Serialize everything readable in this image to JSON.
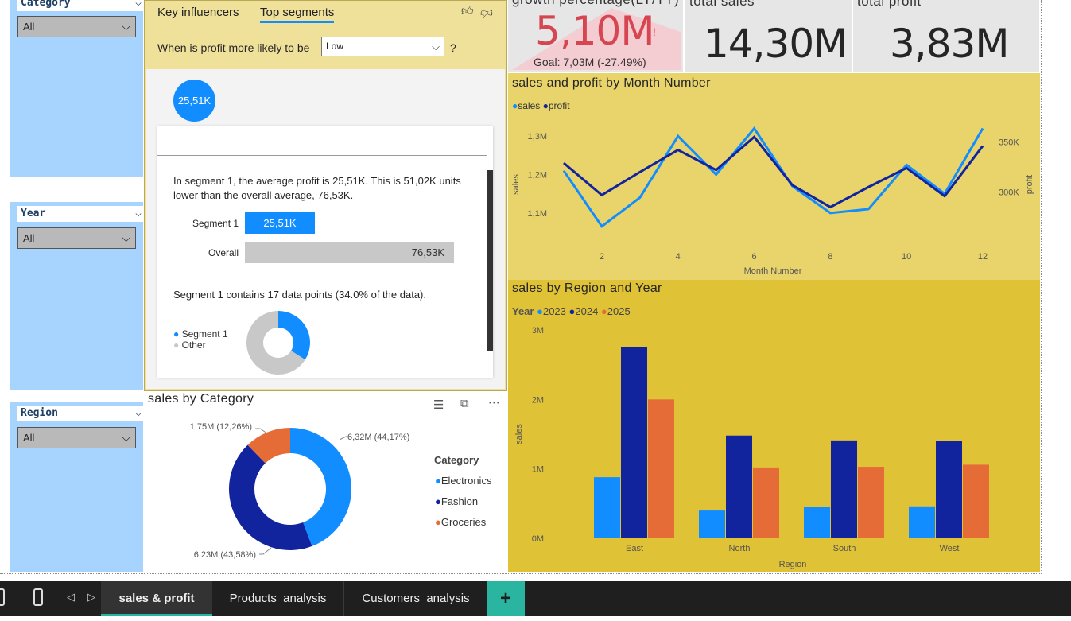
{
  "slicers": [
    {
      "title": "Category",
      "value": "All"
    },
    {
      "title": "Year",
      "value": "All"
    },
    {
      "title": "Region",
      "value": "All"
    }
  ],
  "key_influencers": {
    "tabs": [
      "Key influencers",
      "Top segments"
    ],
    "question_prefix": "When is profit more likely to be",
    "question_value": "Low",
    "question_suffix": "?",
    "segment_bubble": "25,51K",
    "segment_description": "In segment 1, the average profit is 25,51K. This is 51,02K units lower than the overall average, 76,53K.",
    "segment_label": "Segment 1",
    "segment_value": "25,51K",
    "overall_label": "Overall",
    "overall_value": "76,53K",
    "segment_value_num": 25.51,
    "overall_value_num": 76.53,
    "data_points_text": "Segment 1 contains 17 data points (34.0% of the data).",
    "share_percent": 34.0,
    "legend": [
      "Segment 1",
      "Other"
    ]
  },
  "kpis": [
    {
      "title": "growth percentage(LY/TY)",
      "value": "5,10M",
      "marker": "!",
      "goal": "Goal: 7,03M (-27.49%)",
      "color": "#d64550"
    },
    {
      "title": "total sales",
      "value": "14,30M"
    },
    {
      "title": "total profit",
      "value": "3,83M"
    }
  ],
  "colors": {
    "sales": "#118dff",
    "profit": "#12239e",
    "y2025": "#e66c37",
    "segment": "#118dff",
    "other": "#c8c8c8"
  },
  "line_chart": {
    "title": "sales and profit by Month Number",
    "legend": [
      "sales",
      "profit"
    ],
    "xlabel": "Month Number",
    "ylabel_left": "sales",
    "ylabel_right": "profit",
    "left_ticks": [
      "1,3M",
      "1,2M",
      "1,1M"
    ],
    "right_ticks": [
      "350K",
      "300K"
    ],
    "x_ticks": [
      "2",
      "4",
      "6",
      "8",
      "10",
      "12"
    ]
  },
  "bar_chart": {
    "title": "sales by Region and Year",
    "legend_title": "Year",
    "legend": [
      "2023",
      "2024",
      "2025"
    ],
    "ylabel": "sales",
    "xlabel": "Region",
    "y_ticks": [
      "3M",
      "2M",
      "1M",
      "0M"
    ],
    "categories": [
      "East",
      "North",
      "South",
      "West"
    ]
  },
  "donut_chart": {
    "title": "sales by Category",
    "legend_title": "Category",
    "legend": [
      "Electronics",
      "Fashion",
      "Groceries"
    ],
    "labels": [
      "6,32M (44,17%)",
      "6,23M (43,58%)",
      "1,75M (12,26%)"
    ]
  },
  "chart_data": [
    {
      "type": "line",
      "title": "sales and profit by Month Number",
      "xlabel": "Month Number",
      "ylabel": "sales",
      "x": [
        1,
        2,
        3,
        4,
        5,
        6,
        7,
        8,
        9,
        10,
        11,
        12
      ],
      "xlim": [
        1,
        12
      ],
      "ylim": [
        1.05,
        1.35
      ],
      "y2lim": [
        260,
        375
      ],
      "series": [
        {
          "name": "sales",
          "axis": "left",
          "unit": "M",
          "values": [
            1.21,
            1.065,
            1.14,
            1.3,
            1.2,
            1.32,
            1.17,
            1.1,
            1.11,
            1.225,
            1.15,
            1.32
          ]
        },
        {
          "name": "profit",
          "axis": "right",
          "unit": "K",
          "values": [
            329,
            297,
            320,
            342,
            322,
            355,
            307,
            285,
            305,
            324,
            296,
            346
          ]
        }
      ]
    },
    {
      "type": "bar",
      "title": "sales by Region and Year",
      "xlabel": "Region",
      "ylabel": "sales",
      "categories": [
        "East",
        "North",
        "South",
        "West"
      ],
      "ylim": [
        0,
        3.0
      ],
      "unit": "M",
      "series": [
        {
          "name": "2023",
          "values": [
            0.88,
            0.4,
            0.45,
            0.46
          ]
        },
        {
          "name": "2024",
          "values": [
            2.75,
            1.48,
            1.41,
            1.4
          ]
        },
        {
          "name": "2025",
          "values": [
            2.0,
            1.02,
            1.03,
            1.06
          ]
        }
      ]
    },
    {
      "type": "pie",
      "title": "sales by Category",
      "categories": [
        "Electronics",
        "Fashion",
        "Groceries"
      ],
      "values": [
        6.32,
        6.23,
        1.75
      ],
      "unit": "M",
      "percents": [
        44.17,
        43.58,
        12.26
      ]
    }
  ],
  "page_tabs": [
    "sales & profit",
    "Products_analysis",
    "Customers_analysis"
  ],
  "add_page_label": "+"
}
